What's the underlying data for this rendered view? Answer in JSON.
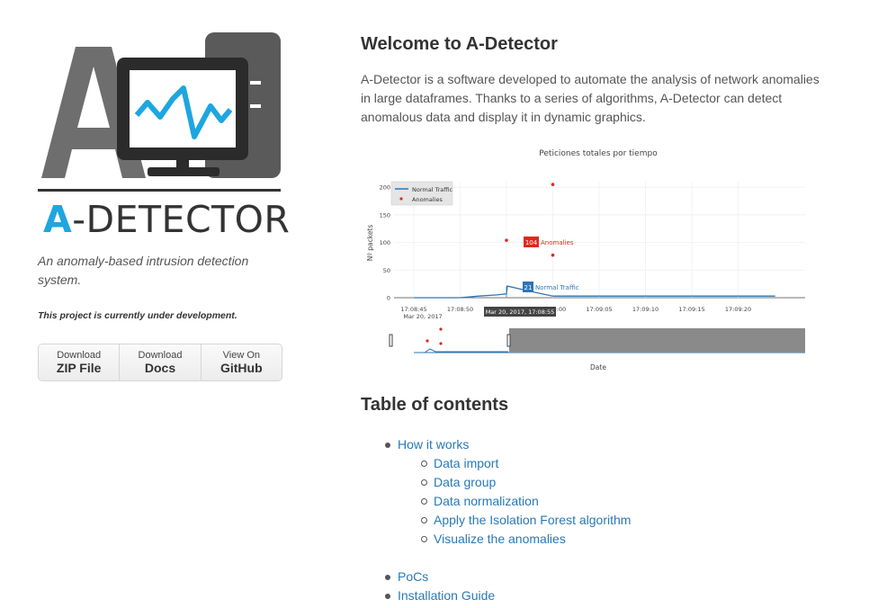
{
  "brand": {
    "name": "A-DETECTOR",
    "name_prefix": "A",
    "name_rest": "-DETECTOR",
    "tagline": "An anomaly-based intrusion detection system.",
    "dev_note": "This project is currently under development.",
    "accent_color": "#1ea6e0"
  },
  "downloads": [
    {
      "small": "Download",
      "big": "ZIP File"
    },
    {
      "small": "Download",
      "big": "Docs"
    },
    {
      "small": "View On",
      "big": "GitHub"
    }
  ],
  "main": {
    "title": "Welcome to A-Detector",
    "intro": "A-Detector is a software developed to automate the analysis of network anomalies in large dataframes. Thanks to a series of algorithms, A-Detector can detect anomalous data and display it in dynamic graphics."
  },
  "chart_data": {
    "type": "line",
    "title": "Peticiones totales por tiempo",
    "xlabel": "Date",
    "ylabel": "Nº packets",
    "ylim": [
      0,
      210
    ],
    "y_ticks": [
      "0",
      "50",
      "100",
      "150",
      "200"
    ],
    "x_ticks": [
      "17:08:45",
      "17:08:50",
      "17:08:55",
      "17:09:00",
      "17:09:05",
      "17:09:10",
      "17:09:15",
      "17:09:20"
    ],
    "x_tick_sub": "Mar 20, 2017",
    "legend_position": "top-left",
    "series": [
      {
        "name": "Normal Traffic",
        "color": "#2e75b6",
        "x": [
          "17:08:45",
          "17:08:50",
          "17:08:52",
          "17:08:54",
          "17:08:55",
          "17:08:55.1",
          "17:08:58",
          "17:09:00",
          "17:09:24"
        ],
        "values": [
          0,
          0,
          3,
          5,
          7,
          21,
          10,
          3,
          3
        ]
      },
      {
        "name": "Anomalies",
        "color": "#e0281d",
        "x": [
          "17:08:55",
          "17:09:00",
          "17:09:00"
        ],
        "values": [
          104,
          205,
          77
        ]
      }
    ],
    "hover": {
      "x_label": "Mar 20, 2017, 17:08:55",
      "anomaly_value": "104",
      "anomaly_name": "Anomalies",
      "normal_value": "21",
      "normal_name": "Normal Traffic"
    }
  },
  "toc": {
    "title": "Table of contents",
    "items": [
      {
        "label": "How it works"
      },
      {
        "label": "Data import"
      },
      {
        "label": "Data group"
      },
      {
        "label": "Data normalization"
      },
      {
        "label": "Apply the Isolation Forest algorithm"
      },
      {
        "label": "Visualize the anomalies"
      },
      {
        "label": "PoCs"
      },
      {
        "label": "Installation Guide"
      }
    ]
  }
}
